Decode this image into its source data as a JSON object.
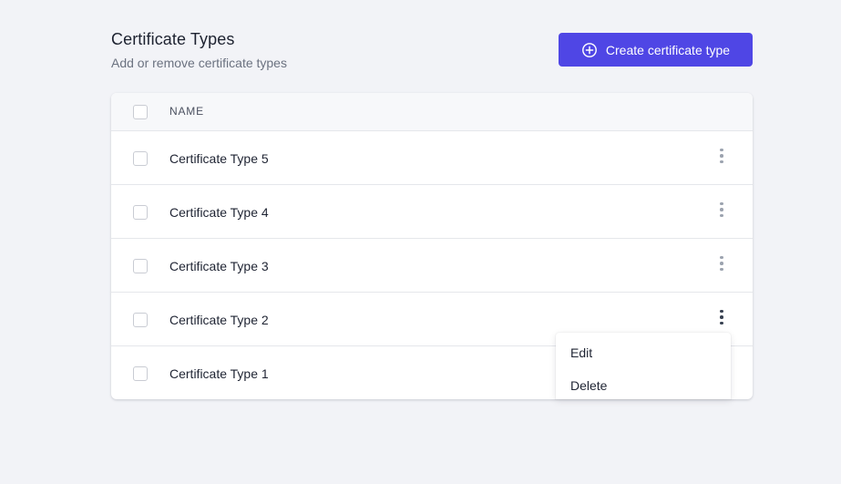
{
  "header": {
    "title": "Certificate Types",
    "subtitle": "Add or remove certificate types",
    "create_button_label": "Create certificate type",
    "create_button_icon": "plus-circle-icon"
  },
  "table": {
    "columns": [
      "NAME"
    ],
    "rows": [
      {
        "name": "Certificate Type 5"
      },
      {
        "name": "Certificate Type 4"
      },
      {
        "name": "Certificate Type 3"
      },
      {
        "name": "Certificate Type 2"
      },
      {
        "name": "Certificate Type 1"
      }
    ],
    "row_menu_icon": "more-vertical-icon",
    "active_row_index": 3
  },
  "row_menu": {
    "items": [
      "Edit",
      "Delete"
    ]
  },
  "colors": {
    "accent": "#4f46e5",
    "background": "#f2f3f7",
    "card": "#ffffff"
  }
}
